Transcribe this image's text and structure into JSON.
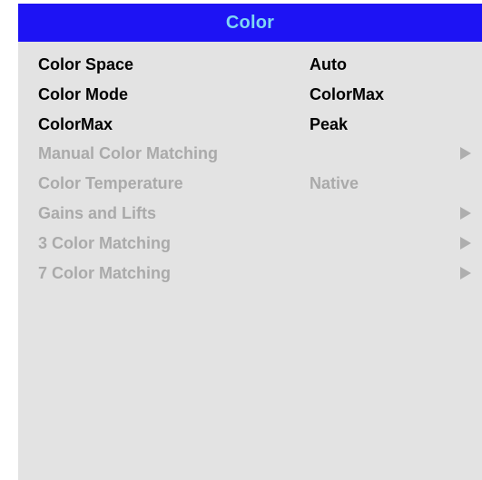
{
  "menu": {
    "title": "Color",
    "colors": {
      "header_bg": "#1d13f4",
      "header_text": "#7fd6f3",
      "panel_bg": "#e3e3e3",
      "enabled_text": "#000000",
      "disabled_text": "#aaaaaa"
    },
    "items": [
      {
        "label": "Color Space",
        "value": "Auto",
        "enabled": true,
        "submenu": false
      },
      {
        "label": "Color Mode",
        "value": "ColorMax",
        "enabled": true,
        "submenu": false
      },
      {
        "label": "ColorMax",
        "value": "Peak",
        "enabled": true,
        "submenu": false
      },
      {
        "label": "Manual Color Matching",
        "value": "",
        "enabled": false,
        "submenu": true,
        "icon": "triangle-right-icon"
      },
      {
        "label": "Color Temperature",
        "value": "Native",
        "enabled": false,
        "submenu": false
      },
      {
        "label": "Gains and Lifts",
        "value": "",
        "enabled": false,
        "submenu": true,
        "icon": "triangle-right-icon"
      },
      {
        "label": "3 Color Matching",
        "value": "",
        "enabled": false,
        "submenu": true,
        "icon": "triangle-right-icon"
      },
      {
        "label": "7 Color Matching",
        "value": "",
        "enabled": false,
        "submenu": true,
        "icon": "triangle-right-icon"
      }
    ]
  }
}
